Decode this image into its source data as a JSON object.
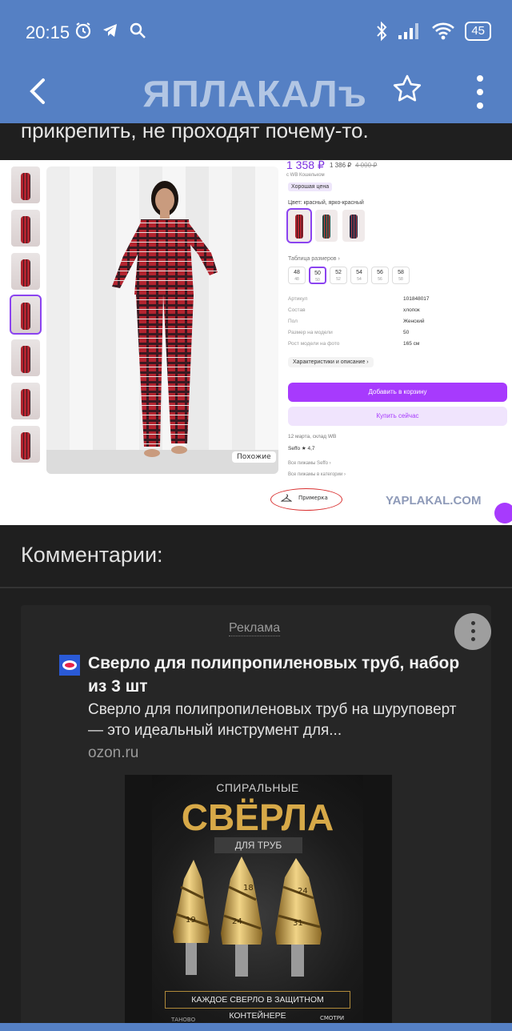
{
  "status_bar": {
    "time": "20:15",
    "left_icons": [
      "alarm-icon",
      "telegram-icon",
      "search-icon"
    ],
    "right_icons": [
      "bluetooth-icon",
      "signal-icon",
      "wifi-icon"
    ],
    "battery": "45"
  },
  "app_bar": {
    "logo_text": "ЯПЛАКАЛъ",
    "color": "#5580c4"
  },
  "post": {
    "text_fragment": "прикрепить, не проходят почему-то."
  },
  "screenshot": {
    "price": "1 358 ₽",
    "price_wallet": "1 386 ₽",
    "price_old": "4 000 ₽",
    "wallet_note": "с WB Кошельком",
    "good_price_badge": "Хорошая цена",
    "color_label": "Цвет: красный, ярко-красный",
    "size_table_label": "Таблица размеров ›",
    "sizes": [
      {
        "ru": "48",
        "sub": "48"
      },
      {
        "ru": "50",
        "sub": "50"
      },
      {
        "ru": "52",
        "sub": "52"
      },
      {
        "ru": "54",
        "sub": "54"
      },
      {
        "ru": "56",
        "sub": "56"
      },
      {
        "ru": "58",
        "sub": "58"
      }
    ],
    "specs": [
      {
        "k": "Артикул",
        "v": "101848017"
      },
      {
        "k": "Состав",
        "v": "хлопок"
      },
      {
        "k": "Пол",
        "v": "Женский"
      },
      {
        "k": "Размер на модели",
        "v": "50"
      },
      {
        "k": "Рост модели на фото",
        "v": "165 см"
      }
    ],
    "characteristics_button": "Характеристики и описание ›",
    "add_to_cart": "Добавить в корзину",
    "buy_now": "Купить сейчас",
    "delivery": "12 марта, склад WB",
    "seller": "Seffo ★ 4,7",
    "all_pajamas": "Все пижамы Seffo ›",
    "all_category": "Все пижамы в категории ›",
    "similar_button": "Похожие",
    "fitting_label": "Примерка",
    "watermark": "YAPLAKAL.COM"
  },
  "comments": {
    "title": "Комментарии:"
  },
  "ad": {
    "label": "Реклама",
    "title": "Сверло для полипропиленовых труб, набор из 3 шт",
    "description": "Сверло для полипропиленовых труб на шуруповерт — это идеальный инструмент для...",
    "domain": "ozon.ru",
    "image": {
      "top": "СПИРАЛЬНЫЕ",
      "big": "СВЁРЛА",
      "sub": "ДЛЯ ТРУБ",
      "drill_labels": [
        "19",
        "24",
        "18",
        "24",
        "31"
      ],
      "caption": "КАЖДОЕ СВЕРЛО В ЗАЩИТНОМ КОНТЕЙНЕРЕ",
      "bottom_left": "ТАНОВО",
      "bottom_right": "СМОТРИ"
    }
  }
}
